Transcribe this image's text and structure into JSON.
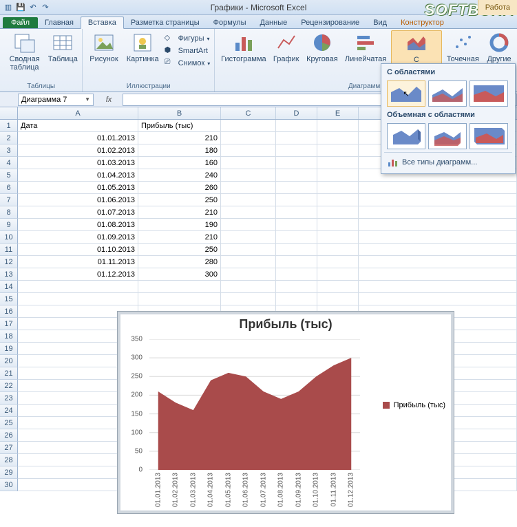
{
  "window_title": "Графики - Microsoft Excel",
  "watermark": "SOFTBUKA",
  "context_tab": "Работа",
  "tabs": {
    "file": "Файл",
    "items": [
      "Главная",
      "Вставка",
      "Разметка страницы",
      "Формулы",
      "Данные",
      "Рецензирование",
      "Вид",
      "Конструктор"
    ],
    "active_index": 1
  },
  "ribbon": {
    "groups": {
      "tables": {
        "label": "Таблицы",
        "pivot": "Сводная\nтаблица",
        "table": "Таблица"
      },
      "illustrations": {
        "label": "Иллюстрации",
        "picture": "Рисунок",
        "clipart": "Картинка",
        "shapes": "Фигуры",
        "smartart": "SmartArt",
        "screenshot": "Снимок"
      },
      "charts": {
        "label": "Диаграммы",
        "column": "Гистограмма",
        "line": "График",
        "pie": "Круговая",
        "bar": "Линейчатая",
        "area": "С\nобластями",
        "scatter": "Точечная",
        "other": "Другие"
      }
    }
  },
  "gallery": {
    "sec1": "С областями",
    "sec2": "Объемная с областями",
    "footer_text": "Все типы диаграмм..."
  },
  "name_box": "Диаграмма 7",
  "fx_label": "fx",
  "columns": [
    "A",
    "B",
    "C",
    "D",
    "E"
  ],
  "headers": {
    "A": "Дата",
    "B": "Прибыль (тыс)"
  },
  "data_rows": [
    {
      "A": "01.01.2013",
      "B": "210"
    },
    {
      "A": "01.02.2013",
      "B": "180"
    },
    {
      "A": "01.03.2013",
      "B": "160"
    },
    {
      "A": "01.04.2013",
      "B": "240"
    },
    {
      "A": "01.05.2013",
      "B": "260"
    },
    {
      "A": "01.06.2013",
      "B": "250"
    },
    {
      "A": "01.07.2013",
      "B": "210"
    },
    {
      "A": "01.08.2013",
      "B": "190"
    },
    {
      "A": "01.09.2013",
      "B": "210"
    },
    {
      "A": "01.10.2013",
      "B": "250"
    },
    {
      "A": "01.11.2013",
      "B": "280"
    },
    {
      "A": "01.12.2013",
      "B": "300"
    }
  ],
  "row_count": 30,
  "chart_data": {
    "type": "area",
    "title": "Прибыль (тыс)",
    "legend": "Прибыль (тыс)",
    "categories": [
      "01.01.2013",
      "01.02.2013",
      "01.03.2013",
      "01.04.2013",
      "01.05.2013",
      "01.06.2013",
      "01.07.2013",
      "01.08.2013",
      "01.09.2013",
      "01.10.2013",
      "01.11.2013",
      "01.12.2013"
    ],
    "values": [
      210,
      180,
      160,
      240,
      260,
      250,
      210,
      190,
      210,
      250,
      280,
      300
    ],
    "ylim": [
      0,
      350
    ],
    "ystep": 50,
    "series_color": "#a94b4b"
  }
}
